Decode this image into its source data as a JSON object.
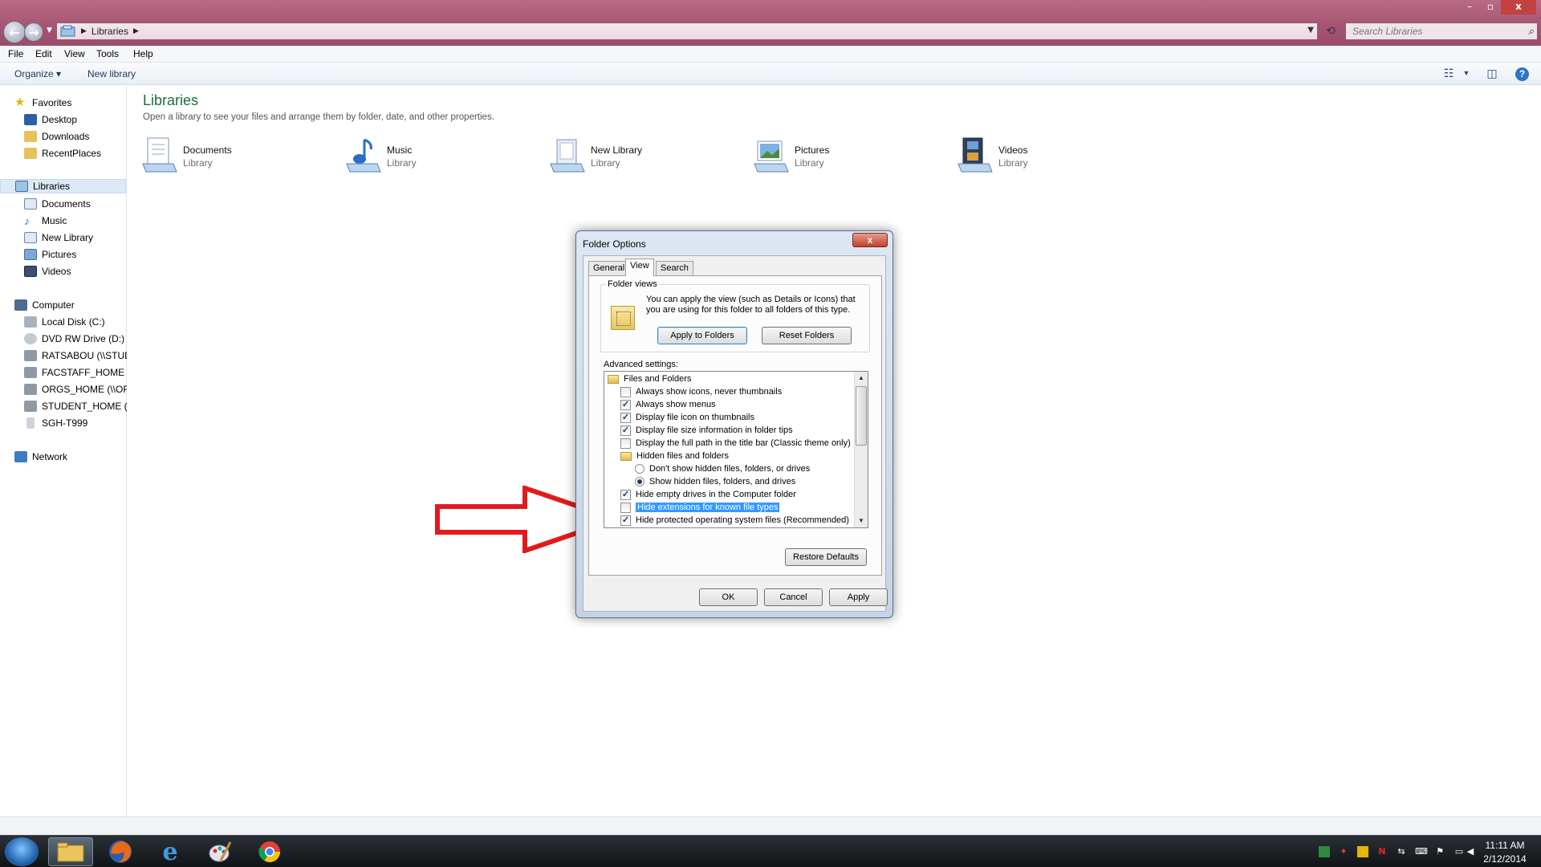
{
  "window": {
    "breadcrumb": [
      "Libraries"
    ],
    "search_placeholder": "Search Libraries",
    "controls": {
      "minimize": "–",
      "maximize": "▫",
      "close": "x"
    }
  },
  "menu": [
    "File",
    "Edit",
    "View",
    "Tools",
    "Help"
  ],
  "commands": {
    "organize": "Organize ▾",
    "new_library": "New library"
  },
  "nav": {
    "favorites": {
      "label": "Favorites",
      "items": [
        "Desktop",
        "Downloads",
        "RecentPlaces"
      ]
    },
    "libraries": {
      "label": "Libraries",
      "items": [
        "Documents",
        "Music",
        "New Library",
        "Pictures",
        "Videos"
      ]
    },
    "computer": {
      "label": "Computer",
      "items": [
        "Local Disk (C:)",
        "DVD RW Drive (D:)",
        "RATSABOU (\\\\STUD",
        "FACSTAFF_HOME (\\",
        "ORGS_HOME (\\\\ORG",
        "STUDENT_HOME (\\\\",
        "SGH-T999"
      ]
    },
    "network": {
      "label": "Network"
    }
  },
  "content": {
    "title": "Libraries",
    "subtitle": "Open a library to see your files and arrange them by folder, date, and other properties.",
    "libraries": [
      {
        "name": "Documents",
        "type": "Library"
      },
      {
        "name": "Music",
        "type": "Library"
      },
      {
        "name": "New Library",
        "type": "Library"
      },
      {
        "name": "Pictures",
        "type": "Library"
      },
      {
        "name": "Videos",
        "type": "Library"
      }
    ]
  },
  "dialog": {
    "title": "Folder Options",
    "close": "x",
    "tabs": [
      "General",
      "View",
      "Search"
    ],
    "active_tab": "View",
    "folder_views": {
      "label": "Folder views",
      "description": "You can apply the view (such as Details or Icons) that you are using for this folder to all folders of this type.",
      "apply_button": "Apply to Folders",
      "reset_button": "Reset Folders"
    },
    "advanced_label": "Advanced settings:",
    "advanced_items": [
      {
        "kind": "folder",
        "label": "Files and Folders",
        "indent": 0
      },
      {
        "kind": "check",
        "label": "Always show icons, never thumbnails",
        "checked": false,
        "indent": 1
      },
      {
        "kind": "check",
        "label": "Always show menus",
        "checked": true,
        "indent": 1
      },
      {
        "kind": "check",
        "label": "Display file icon on thumbnails",
        "checked": true,
        "indent": 1
      },
      {
        "kind": "check",
        "label": "Display file size information in folder tips",
        "checked": true,
        "indent": 1
      },
      {
        "kind": "check",
        "label": "Display the full path in the title bar (Classic theme only)",
        "checked": false,
        "indent": 1
      },
      {
        "kind": "folder",
        "label": "Hidden files and folders",
        "indent": 1
      },
      {
        "kind": "radio",
        "label": "Don't show hidden files, folders, or drives",
        "checked": false,
        "indent": 2
      },
      {
        "kind": "radio",
        "label": "Show hidden files, folders, and drives",
        "checked": true,
        "indent": 2
      },
      {
        "kind": "check",
        "label": "Hide empty drives in the Computer folder",
        "checked": true,
        "indent": 1
      },
      {
        "kind": "check",
        "label": "Hide extensions for known file types",
        "checked": false,
        "indent": 1,
        "selected": true
      },
      {
        "kind": "check",
        "label": "Hide protected operating system files (Recommended)",
        "checked": true,
        "indent": 1
      }
    ],
    "restore_defaults": "Restore Defaults",
    "ok": "OK",
    "cancel": "Cancel",
    "apply": "Apply"
  },
  "taskbar": {
    "time": "11:11 AM",
    "date": "2/12/2014"
  },
  "colors": {
    "annotation_arrow": "#e01b1b",
    "selection": "#3399ff",
    "title_bar": "#a45472"
  }
}
